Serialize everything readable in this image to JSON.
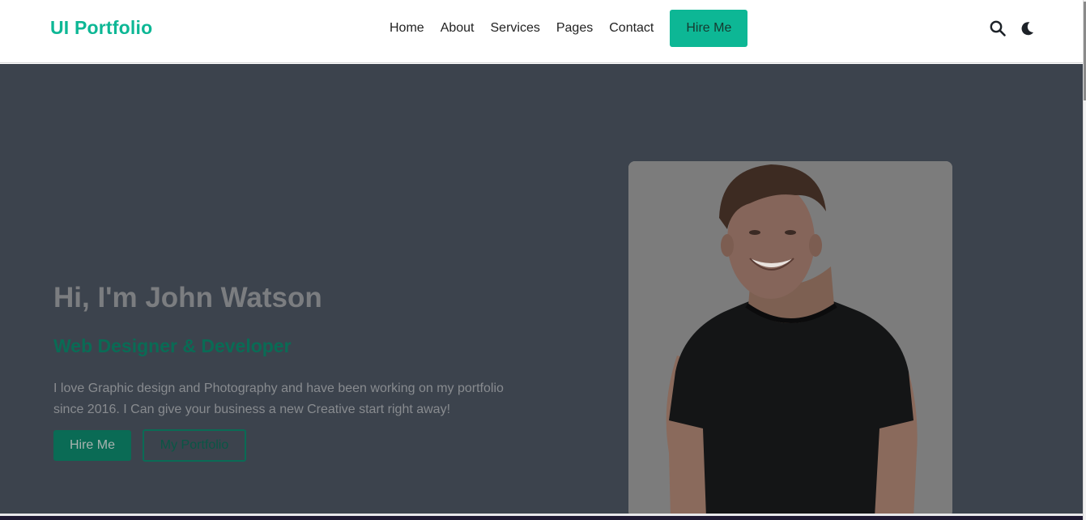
{
  "header": {
    "logo": "UI Portfolio",
    "nav": [
      "Home",
      "About",
      "Services",
      "Pages",
      "Contact"
    ],
    "cta": "Hire Me",
    "icons": [
      "search-icon",
      "moon-icon"
    ]
  },
  "hero": {
    "title": "Hi, I'm John Watson",
    "subtitle": "Web Designer & Developer",
    "description": "I love Graphic design and Photography and have been working on my portfolio since 2016. I Can give your business a new Creative start right away!",
    "primary_button": "Hire Me",
    "secondary_button": "My Portfolio",
    "photo": "portrait of a smiling man in a black t-shirt"
  },
  "colors": {
    "accent": "#0db795",
    "hero_bg": "#3c434d",
    "header_bg": "#ffffff"
  }
}
